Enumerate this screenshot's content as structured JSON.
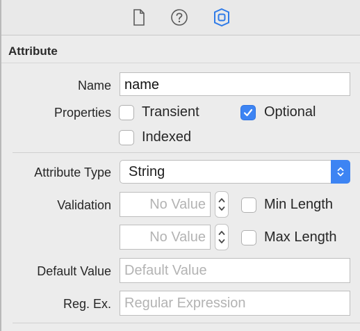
{
  "toolbar": {
    "icons": [
      "file-inspector-icon",
      "quick-help-icon",
      "data-model-inspector-icon"
    ]
  },
  "section": {
    "title": "Attribute"
  },
  "name": {
    "label": "Name",
    "value": "name"
  },
  "properties": {
    "label": "Properties",
    "transient": {
      "label": "Transient",
      "checked": false
    },
    "optional": {
      "label": "Optional",
      "checked": true
    },
    "indexed": {
      "label": "Indexed",
      "checked": false
    }
  },
  "attribute_type": {
    "label": "Attribute Type",
    "value": "String"
  },
  "validation": {
    "label": "Validation",
    "min": {
      "placeholder": "No Value",
      "checkbox_label": "Min Length",
      "checked": false
    },
    "max": {
      "placeholder": "No Value",
      "checkbox_label": "Max Length",
      "checked": false
    }
  },
  "default_value": {
    "label": "Default Value",
    "placeholder": "Default Value"
  },
  "regex": {
    "label": "Reg. Ex.",
    "placeholder": "Regular Expression"
  },
  "colors": {
    "accent": "#3d84f3",
    "background": "#ececec"
  }
}
